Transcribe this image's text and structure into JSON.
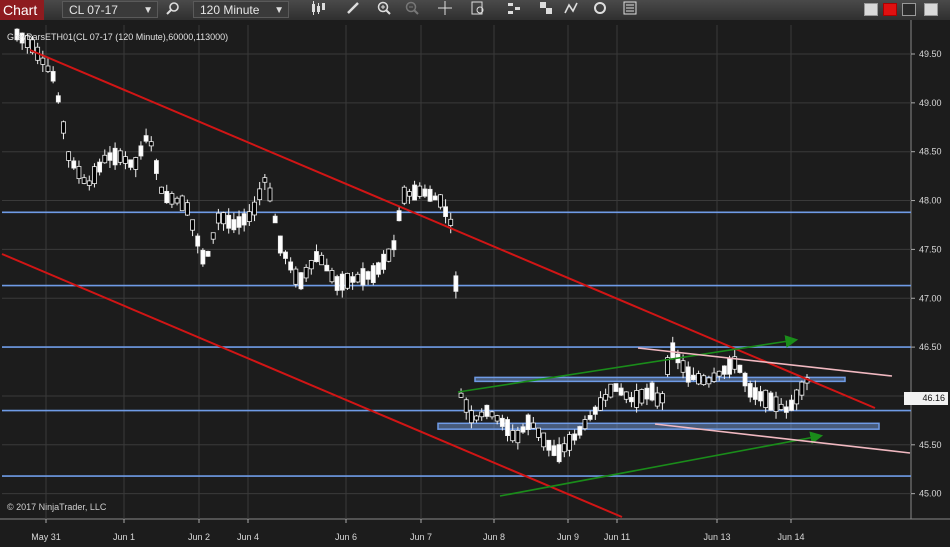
{
  "toolbar": {
    "chart_tab_label": "Chart",
    "instrument": "CL 07-17",
    "interval": "120 Minute",
    "icons": [
      "search-icon",
      "bar-type-icon",
      "pencil-icon",
      "zoom-in-icon",
      "zoom-out-icon",
      "crosshair-icon",
      "data-box-icon",
      "bar-chart-icon",
      "strategy-icon",
      "indicators-icon",
      "refresh-icon",
      "properties-icon"
    ],
    "window_buttons": [
      "restore-icon",
      "close-icon",
      "maximize-icon"
    ]
  },
  "chart": {
    "title": "GreyBarsETH01(CL 07-17 (120 Minute),60000,113000)",
    "copyright": "© 2017 NinjaTrader, LLC",
    "last_price_label": "46.16",
    "y_ticks": [
      "49.50",
      "49.00",
      "48.50",
      "48.00",
      "47.50",
      "47.00",
      "46.50",
      "46.00",
      "45.50",
      "45.00"
    ],
    "x_ticks": [
      "May 31",
      "Jun 1",
      "Jun 2",
      "Jun 4",
      "Jun 6",
      "Jun 7",
      "Jun 8",
      "Jun 9",
      "Jun 11",
      "Jun 13",
      "Jun 14"
    ],
    "colors": {
      "background": "#1c1c1c",
      "grid": "#3a3a3a",
      "candle_up": "#ffffff",
      "candle_down": "#000000",
      "trend_red": "#d11515",
      "horizontal_blue": "#6f9be6",
      "trend_green": "#1a8c1a",
      "trend_pink": "#f0b8c0",
      "chart_tab": "#8e1b1f"
    }
  },
  "chart_data": {
    "type": "candlestick",
    "ylim": [
      44.95,
      49.75
    ],
    "candle_count": 154,
    "horizontal_levels": [
      47.88,
      47.13,
      46.5,
      45.85,
      45.18
    ],
    "support_zones": [
      {
        "price_top": 46.19,
        "price_bottom": 46.15
      },
      {
        "price_top": 45.72,
        "price_bottom": 45.66
      }
    ],
    "trendlines": [
      {
        "color": "red",
        "from": [
          "May 31",
          49.75
        ],
        "to": [
          "Jun 14",
          46.05
        ]
      },
      {
        "color": "red",
        "from": [
          "May 31",
          47.6
        ],
        "to": [
          "Jun 9",
          44.9
        ]
      },
      {
        "color": "green",
        "from": [
          "Jun 7",
          46.21
        ],
        "to": [
          "Jun 13",
          46.76
        ],
        "arrow": true
      },
      {
        "color": "green",
        "from": [
          "Jun 8",
          45.17
        ],
        "to": [
          "Jun 14",
          45.79
        ],
        "arrow": true
      },
      {
        "color": "pink",
        "from": [
          "Jun 11",
          46.7
        ],
        "to": [
          "Jun 14",
          46.37
        ]
      },
      {
        "color": "pink",
        "from": [
          "Jun 11",
          45.88
        ],
        "to": [
          "Jun 14",
          45.56
        ]
      }
    ]
  }
}
